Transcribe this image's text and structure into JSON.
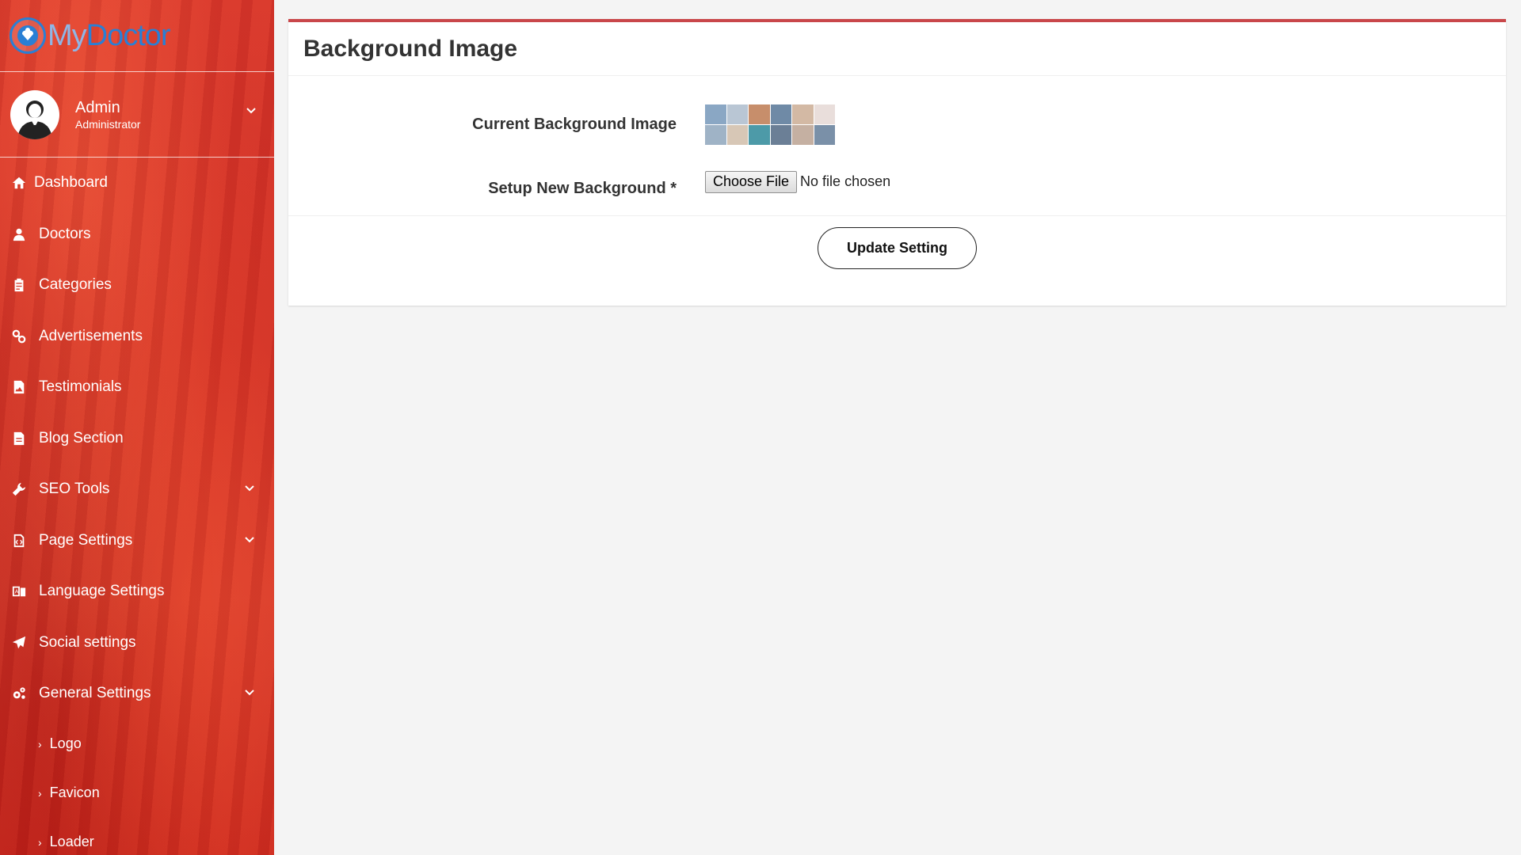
{
  "brand": {
    "name_part1": "My",
    "name_part2": "Doctor"
  },
  "user": {
    "name": "Admin",
    "role": "Administrator"
  },
  "sidebar": {
    "items": [
      {
        "label": "Dashboard",
        "icon": "home-icon",
        "has_submenu": false
      },
      {
        "label": "Doctors",
        "icon": "user-doctor-icon",
        "has_submenu": false
      },
      {
        "label": "Categories",
        "icon": "clipboard-icon",
        "has_submenu": false
      },
      {
        "label": "Advertisements",
        "icon": "link-icon",
        "has_submenu": false
      },
      {
        "label": "Testimonials",
        "icon": "image-file-icon",
        "has_submenu": false
      },
      {
        "label": "Blog Section",
        "icon": "file-text-icon",
        "has_submenu": false
      },
      {
        "label": "SEO Tools",
        "icon": "wrench-icon",
        "has_submenu": true
      },
      {
        "label": "Page Settings",
        "icon": "file-code-icon",
        "has_submenu": true
      },
      {
        "label": "Language Settings",
        "icon": "language-icon",
        "has_submenu": false
      },
      {
        "label": "Social settings",
        "icon": "paper-plane-icon",
        "has_submenu": false
      },
      {
        "label": "General Settings",
        "icon": "gears-icon",
        "has_submenu": true
      }
    ],
    "general_settings_sub": [
      {
        "label": "Logo"
      },
      {
        "label": "Favicon"
      },
      {
        "label": "Loader"
      }
    ]
  },
  "page": {
    "title": "Background Image",
    "current_label": "Current Background Image",
    "new_label": "Setup New Background *",
    "choose_file_label": "Choose File",
    "file_status": "No file chosen",
    "update_button": "Update Setting"
  },
  "colors": {
    "sidebar_red": "#d0312a",
    "card_top_border": "#c9474a",
    "brand_blue": "#2a7fd4",
    "page_background": "#f4f4f4"
  }
}
